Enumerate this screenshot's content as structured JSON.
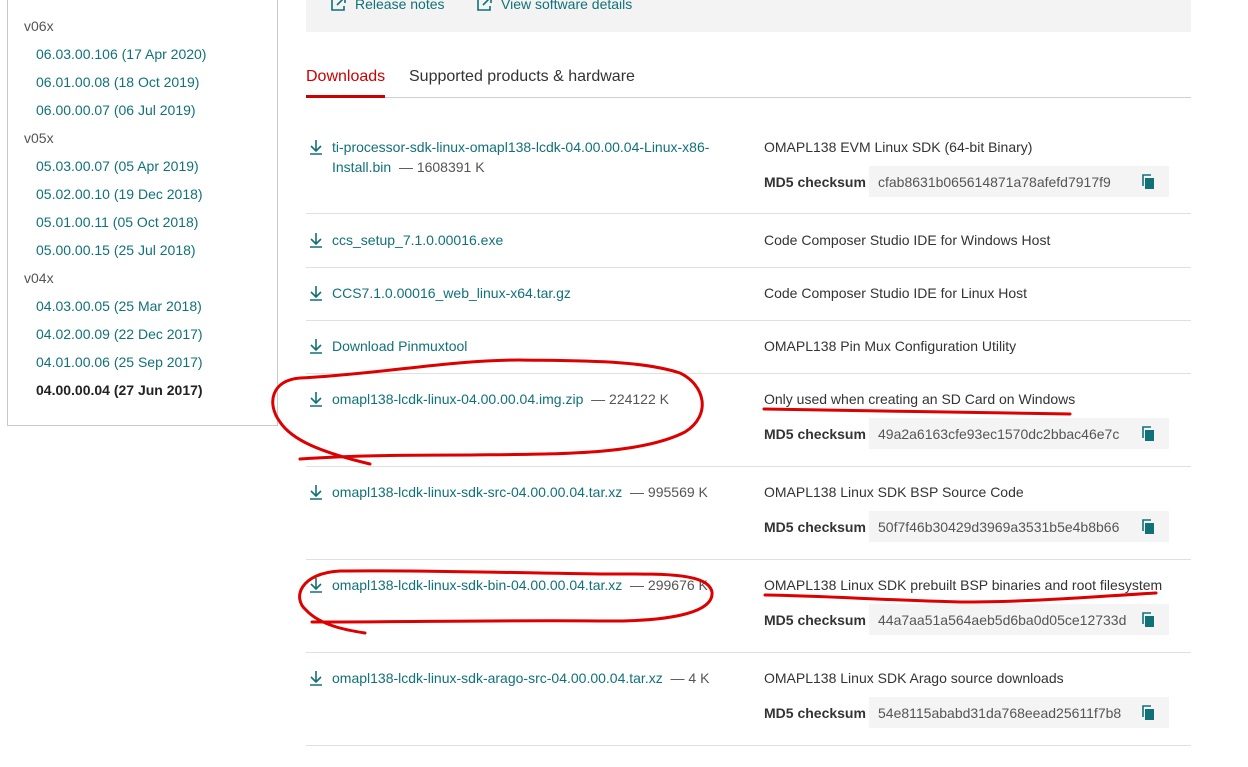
{
  "versions": [
    {
      "group": "v06x",
      "items": [
        "06.03.00.106 (17 Apr 2020)",
        "06.01.00.08 (18 Oct 2019)",
        "06.00.00.07 (06 Jul 2019)"
      ]
    },
    {
      "group": "v05x",
      "items": [
        "05.03.00.07 (05 Apr 2019)",
        "05.02.00.10 (19 Dec 2018)",
        "05.01.00.11 (05 Oct 2018)",
        "05.00.00.15 (25 Jul 2018)"
      ]
    },
    {
      "group": "v04x",
      "items": [
        "04.03.00.05 (25 Mar 2018)",
        "04.02.00.09 (22 Dec 2017)",
        "04.01.00.06 (25 Sep 2017)",
        "04.00.00.04 (27 Jun 2017)"
      ]
    }
  ],
  "current_version": "04.00.00.04 (27 Jun 2017)",
  "top_links": {
    "release_notes": "Release notes",
    "software_details": "View software details"
  },
  "tabs": [
    "Downloads",
    "Supported products & hardware"
  ],
  "md5_label": "MD5 checksum",
  "files": [
    {
      "name": "ti-processor-sdk-linux-omapl138-lcdk-04.00.00.04-Linux-x86-Install.bin",
      "size": "— 1608391 K",
      "description": "OMAPL138 EVM Linux SDK (64-bit Binary)",
      "md5": "cfab8631b065614871a78afefd7917f9"
    },
    {
      "name": "ccs_setup_7.1.0.00016.exe",
      "size": "",
      "description": "Code Composer Studio IDE for Windows Host",
      "md5": null
    },
    {
      "name": "CCS7.1.0.00016_web_linux-x64.tar.gz",
      "size": "",
      "description": "Code Composer Studio IDE for Linux Host",
      "md5": null
    },
    {
      "name": "Download Pinmuxtool",
      "size": "",
      "description": "OMAPL138 Pin Mux Configuration Utility",
      "md5": null
    },
    {
      "name": "omapl138-lcdk-linux-04.00.00.04.img.zip",
      "size": "— 224122 K",
      "description": "Only used when creating an SD Card on Windows",
      "md5": "49a2a6163cfe93ec1570dc2bbac46e7c"
    },
    {
      "name": "omapl138-lcdk-linux-sdk-src-04.00.00.04.tar.xz",
      "size": "— 995569 K",
      "description": "OMAPL138 Linux SDK BSP Source Code",
      "md5": "50f7f46b30429d3969a3531b5e4b8b66"
    },
    {
      "name": "omapl138-lcdk-linux-sdk-bin-04.00.00.04.tar.xz",
      "size": "— 299676 K",
      "description": "OMAPL138 Linux SDK prebuilt BSP binaries and root filesystem",
      "md5": "44a7aa51a564aeb5d6ba0d05ce12733d"
    },
    {
      "name": "omapl138-lcdk-linux-sdk-arago-src-04.00.00.04.tar.xz",
      "size": "— 4 K",
      "description": "OMAPL138 Linux SDK Arago source downloads",
      "md5": "54e8115ababd31da768eead25611f7b8"
    }
  ],
  "colors": {
    "link": "#117179",
    "accent": "#cc0000",
    "annotation": "#dd0000"
  },
  "icons": [
    "external-link-icon",
    "download-icon",
    "copy-icon"
  ]
}
